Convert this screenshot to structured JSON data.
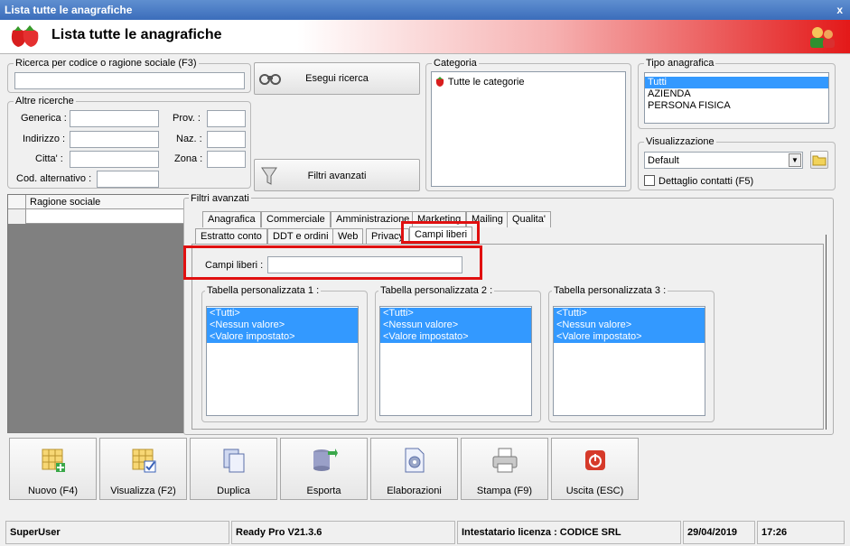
{
  "window": {
    "title": "Lista tutte le anagrafiche",
    "close": "x"
  },
  "header": {
    "title": "Lista tutte le anagrafiche"
  },
  "search": {
    "legend": "Ricerca per codice o ragione sociale (F3)",
    "value": "",
    "button": "Esegui ricerca"
  },
  "altre": {
    "legend": "Altre ricerche",
    "generica": "Generica :",
    "prov": "Prov. :",
    "indirizzo": "Indirizzo :",
    "naz": "Naz. :",
    "citta": "Citta' :",
    "zona": "Zona :",
    "cod_alt": "Cod. alternativo :",
    "filtri_button": "Filtri avanzati"
  },
  "categoria": {
    "legend": "Categoria",
    "item": "Tutte le categorie"
  },
  "tipo": {
    "legend": "Tipo anagrafica",
    "items": [
      "Tutti",
      "AZIENDA",
      "PERSONA FISICA"
    ]
  },
  "visualizzazione": {
    "legend": "Visualizzazione",
    "value": "Default",
    "checkbox": "Dettaglio contatti (F5)"
  },
  "grid": {
    "column": "Ragione sociale"
  },
  "filtri": {
    "legend": "Filtri avanzati",
    "tabs_row1": [
      "Anagrafica",
      "Commerciale",
      "Amministrazione",
      "Marketing",
      "Mailing",
      "Qualita'"
    ],
    "tabs_row2": [
      "Estratto conto",
      "DDT e ordini",
      "Web",
      "Privacy",
      "Campi liberi"
    ],
    "campi_label": "Campi liberi :",
    "tables": [
      {
        "legend": "Tabella personalizzata 1 :",
        "items": [
          "<Tutti>",
          "<Nessun valore>",
          "<Valore impostato>"
        ]
      },
      {
        "legend": "Tabella personalizzata 2 :",
        "items": [
          "<Tutti>",
          "<Nessun valore>",
          "<Valore impostato>"
        ]
      },
      {
        "legend": "Tabella personalizzata 3 :",
        "items": [
          "<Tutti>",
          "<Nessun valore>",
          "<Valore impostato>"
        ]
      }
    ]
  },
  "toolbar": {
    "nuovo": "Nuovo (F4)",
    "visualizza": "Visualizza (F2)",
    "duplica": "Duplica",
    "esporta": "Esporta",
    "elaborazioni": "Elaborazioni",
    "stampa": "Stampa (F9)",
    "uscita": "Uscita (ESC)"
  },
  "status": {
    "user": "SuperUser",
    "version": "Ready Pro V21.3.6",
    "license": "Intestatario licenza : CODICE SRL",
    "date": "29/04/2019",
    "time": "17:26"
  },
  "colors": {
    "accent_red": "#e01010",
    "selection": "#3399ff",
    "title_blue": "#3b6dbb"
  }
}
